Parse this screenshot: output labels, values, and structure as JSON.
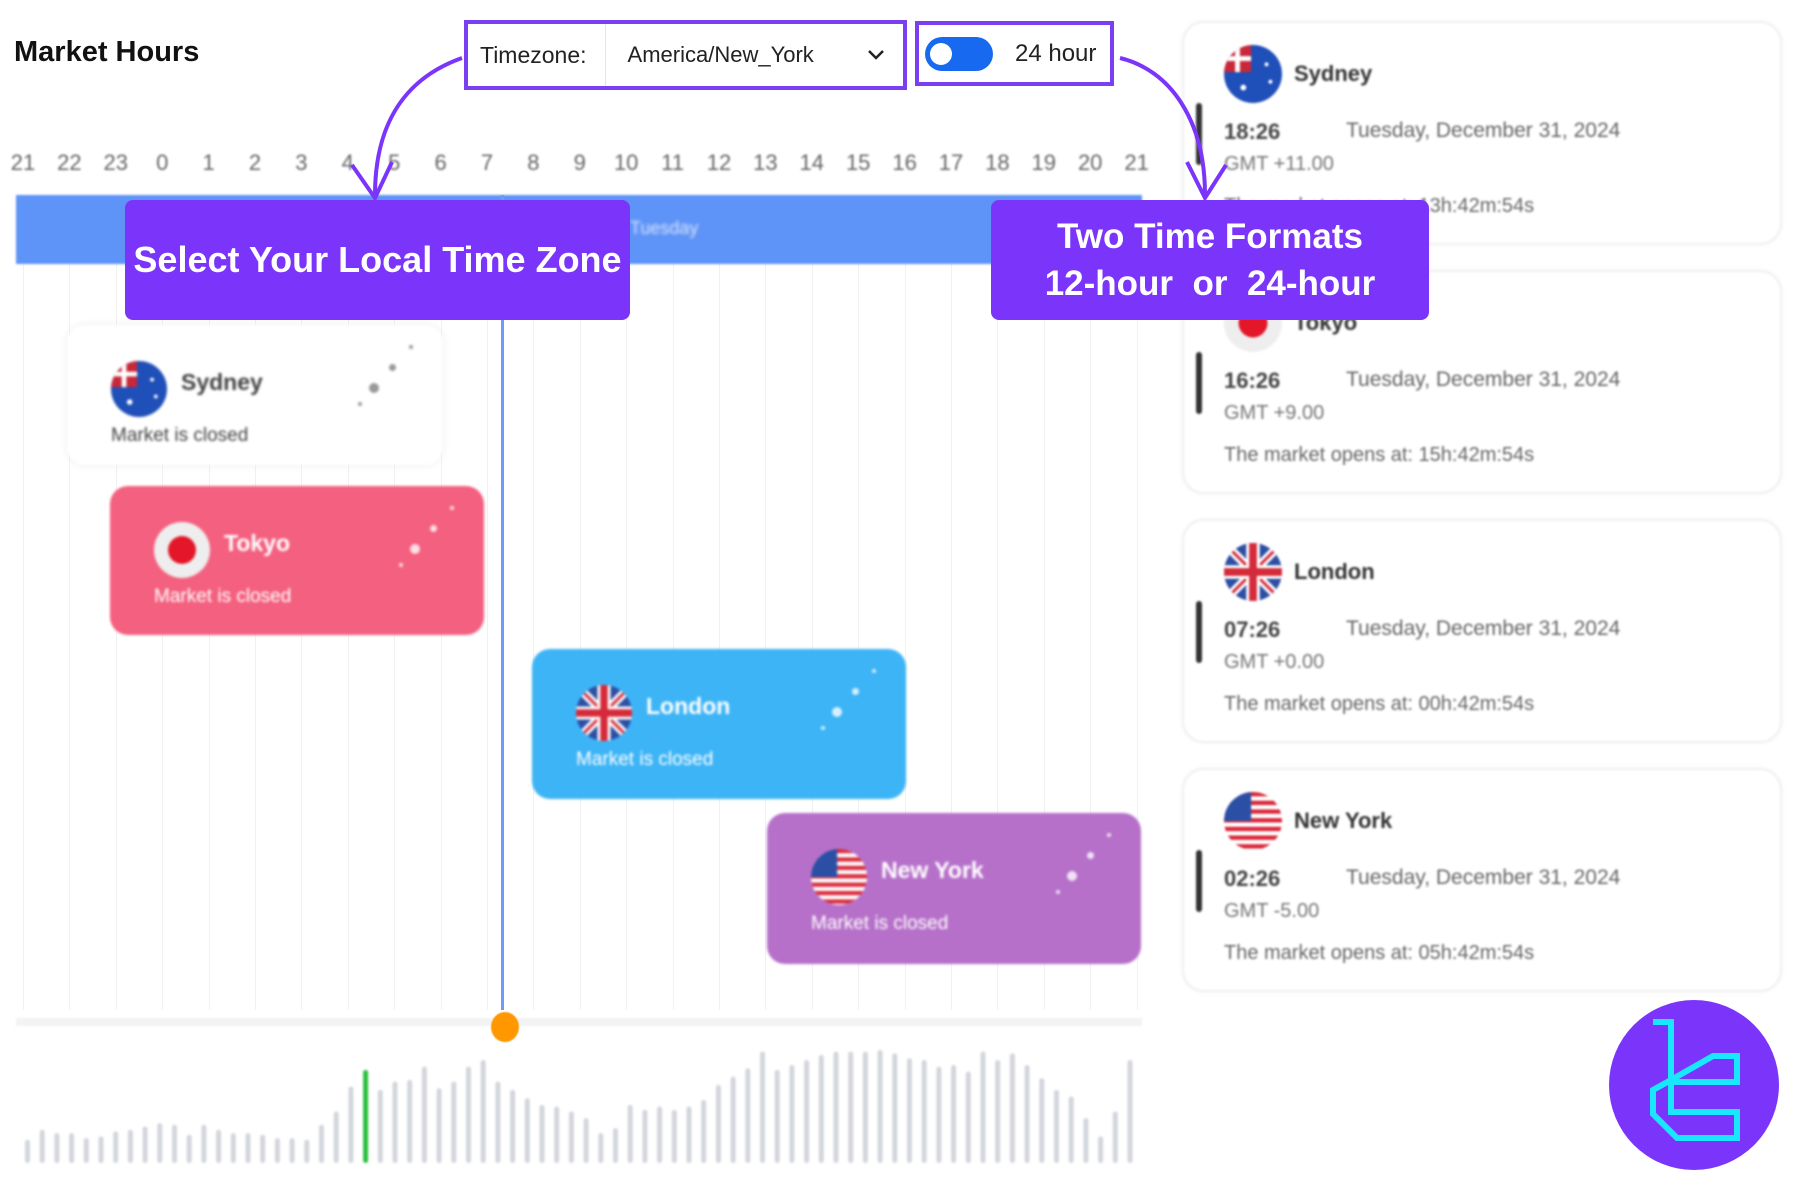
{
  "header": {
    "title": "Market Hours",
    "timezone_label": "Timezone:",
    "timezone_value": "America/New_York",
    "format_label": "24 hour",
    "format_24h": true
  },
  "timeline": {
    "hours": [
      "21",
      "22",
      "23",
      "0",
      "1",
      "2",
      "3",
      "4",
      "5",
      "6",
      "7",
      "8",
      "9",
      "10",
      "11",
      "12",
      "13",
      "14",
      "15",
      "16",
      "17",
      "18",
      "19",
      "20",
      "21"
    ],
    "day_label": "Tuesday",
    "current_hour": 7.43
  },
  "sessions": [
    {
      "city": "Sydney",
      "status": "Market is closed",
      "color": "#ffffff",
      "text_color": "#444444",
      "flag": "australia-flag"
    },
    {
      "city": "Tokyo",
      "status": "Market is closed",
      "color": "#f4607f",
      "text_color": "#ffffff",
      "flag": "japan-flag"
    },
    {
      "city": "London",
      "status": "Market is closed",
      "color": "#3db4f6",
      "text_color": "#ffffff",
      "flag": "uk-flag"
    },
    {
      "city": "New York",
      "status": "Market is closed",
      "color": "#b670c9",
      "text_color": "#ffffff",
      "flag": "us-flag"
    }
  ],
  "callouts": {
    "timezone": "Select Your Local Time Zone",
    "format_line1": "Two Time Formats",
    "format_line2": "12-hour  or  24-hour"
  },
  "clocks": [
    {
      "city": "Sydney",
      "time": "18:26",
      "date": "Tuesday, December 31, 2024",
      "gmt": "GMT +11.00",
      "opens": "The market opens at: 13h:42m:54s",
      "flag": "australia-flag"
    },
    {
      "city": "Tokyo",
      "time": "16:26",
      "date": "Tuesday, December 31, 2024",
      "gmt": "GMT +9.00",
      "opens": "The market opens at: 15h:42m:54s",
      "flag": "japan-flag"
    },
    {
      "city": "London",
      "time": "07:26",
      "date": "Tuesday, December 31, 2024",
      "gmt": "GMT +0.00",
      "opens": "The market opens at: 00h:42m:54s",
      "flag": "uk-flag"
    },
    {
      "city": "New York",
      "time": "02:26",
      "date": "Tuesday, December 31, 2024",
      "gmt": "GMT -5.00",
      "opens": "The market opens at: 05h:42m:54s",
      "flag": "us-flag"
    }
  ],
  "activity": {
    "highlight_index": 23,
    "highlight_color": "#2cc13f",
    "bar_color": "#d3d6dc",
    "values": [
      70,
      100,
      90,
      90,
      75,
      80,
      95,
      100,
      110,
      120,
      115,
      85,
      115,
      100,
      90,
      90,
      85,
      75,
      75,
      70,
      115,
      155,
      230,
      280,
      220,
      245,
      250,
      290,
      225,
      245,
      290,
      310,
      245,
      220,
      195,
      175,
      170,
      155,
      135,
      90,
      105,
      175,
      160,
      170,
      160,
      170,
      190,
      235,
      260,
      285,
      335,
      280,
      295,
      310,
      325,
      335,
      335,
      335,
      340,
      330,
      315,
      310,
      290,
      295,
      275,
      335,
      310,
      330,
      295,
      255,
      220,
      200,
      135,
      80,
      155,
      310
    ]
  },
  "colors": {
    "accent": "#7b35fa",
    "day_bar": "#5e93f7",
    "now_line": "#6c9cf7",
    "handle": "#ff9800",
    "logo_glyph": "#19e6ff"
  }
}
